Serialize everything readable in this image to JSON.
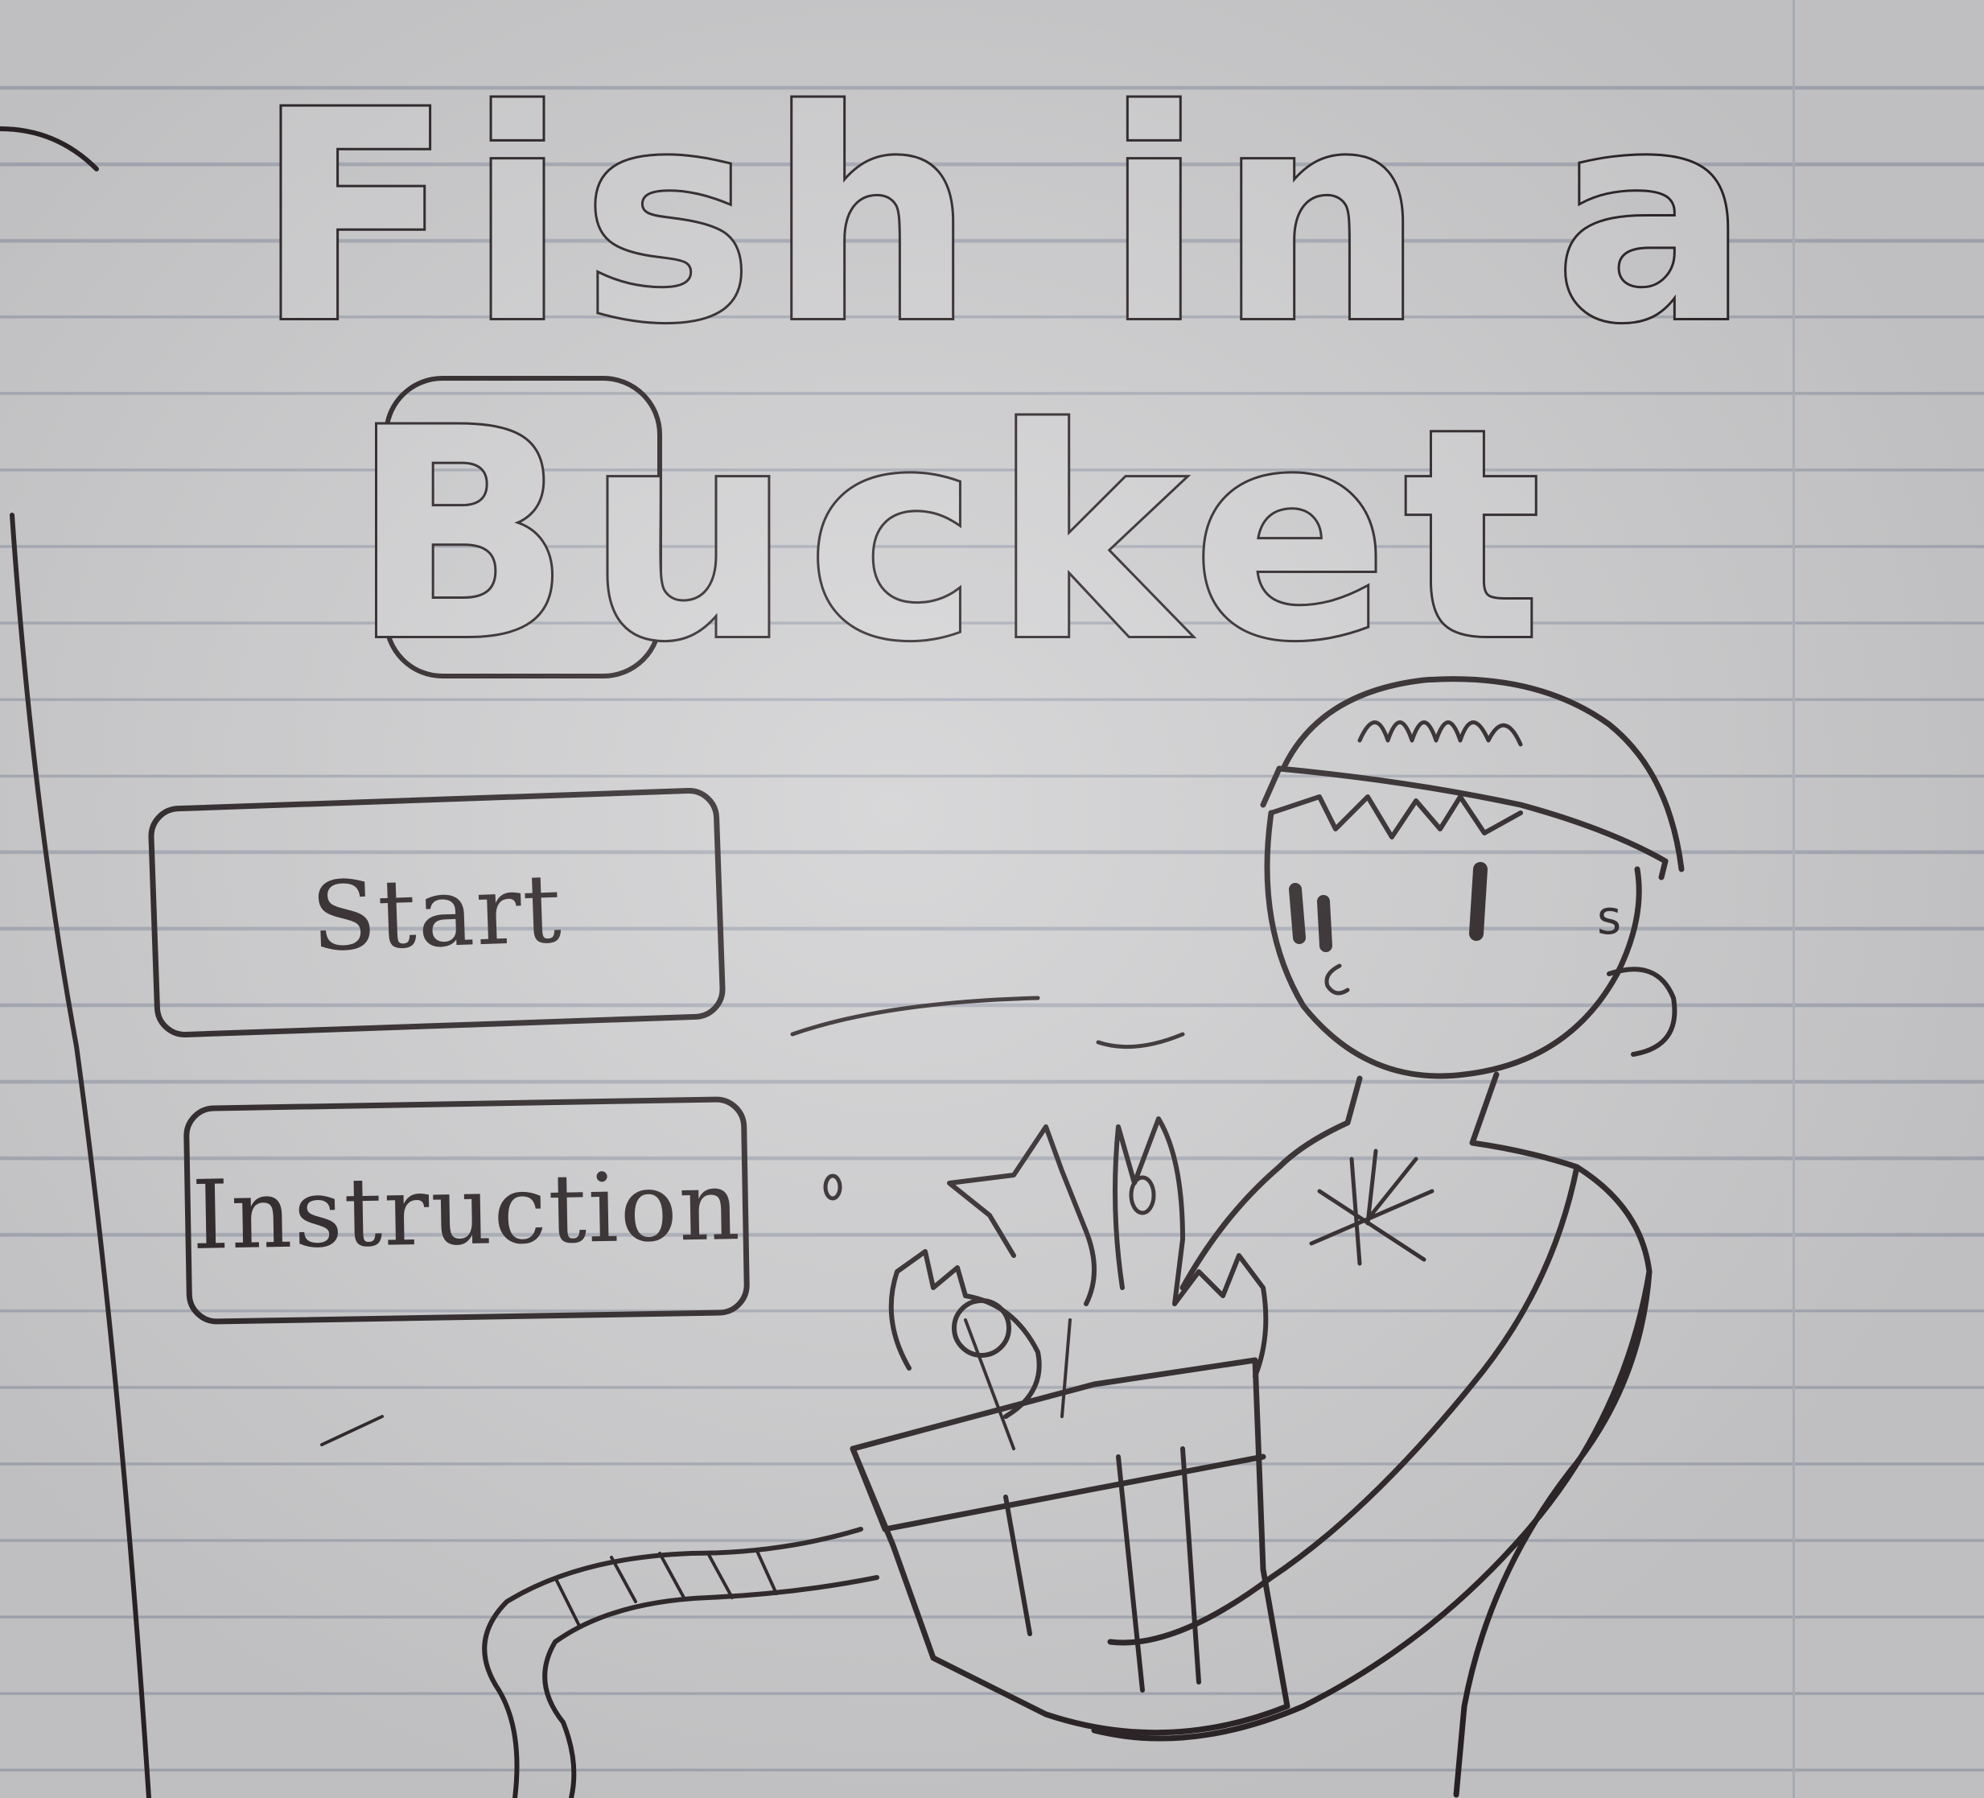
{
  "colors": {
    "paper": "#cfcfd1",
    "ruled_line": "#a9adb8",
    "ink": "#2b2325"
  },
  "title": {
    "line1": "Fish in a",
    "line2": "Bucket"
  },
  "menu": {
    "start_label": "Start",
    "instructions_label": "Instruction"
  },
  "character": {
    "cap_label": "s"
  }
}
